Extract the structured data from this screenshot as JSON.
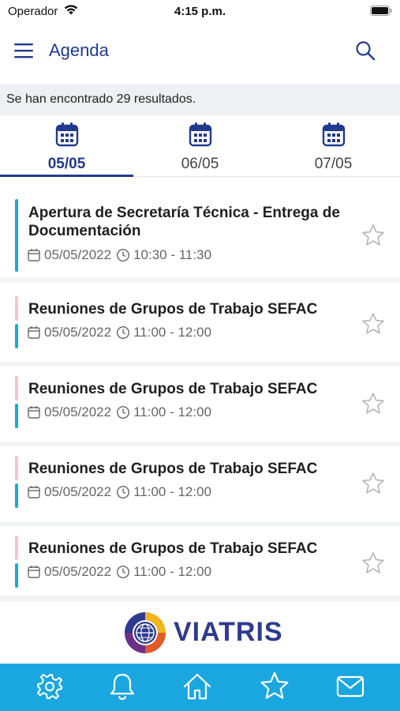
{
  "status_bar": {
    "carrier": "Operador",
    "time": "4:15 p.m."
  },
  "header": {
    "title": "Agenda",
    "menu_icon": "hamburger-menu-icon",
    "search_icon": "search-icon"
  },
  "results": {
    "text": "Se han encontrado 29 resultados."
  },
  "date_tabs": [
    {
      "label": "05/05",
      "active": true,
      "icon": "calendar-icon"
    },
    {
      "label": "06/05",
      "active": false,
      "icon": "calendar-icon"
    },
    {
      "label": "07/05",
      "active": false,
      "icon": "calendar-icon"
    }
  ],
  "events": [
    {
      "title": "Apertura de Secretaría Técnica - Entrega de Documentación",
      "date": "05/05/2022",
      "time": "10:30 - 11:30",
      "favorite": false
    },
    {
      "title": "Reuniones de Grupos de Trabajo SEFAC",
      "date": "05/05/2022",
      "time": "11:00 - 12:00",
      "favorite": false
    },
    {
      "title": "Reuniones de Grupos de Trabajo SEFAC",
      "date": "05/05/2022",
      "time": "11:00 - 12:00",
      "favorite": false
    },
    {
      "title": "Reuniones de Grupos de Trabajo SEFAC",
      "date": "05/05/2022",
      "time": "11:00 - 12:00",
      "favorite": false
    },
    {
      "title": "Reuniones de Grupos de Trabajo SEFAC",
      "date": "05/05/2022",
      "time": "11:00 - 12:00",
      "favorite": false
    }
  ],
  "brand": {
    "name": "VIATRIS"
  },
  "bottom_nav": [
    {
      "icon": "gear-icon"
    },
    {
      "icon": "bell-icon"
    },
    {
      "icon": "home-icon"
    },
    {
      "icon": "star-icon"
    },
    {
      "icon": "mail-icon"
    }
  ],
  "colors": {
    "primary": "#213a8f",
    "accent": "#1aa7e0",
    "pink_bar": "#f2c6cb",
    "results_bg": "#eef0f3"
  }
}
